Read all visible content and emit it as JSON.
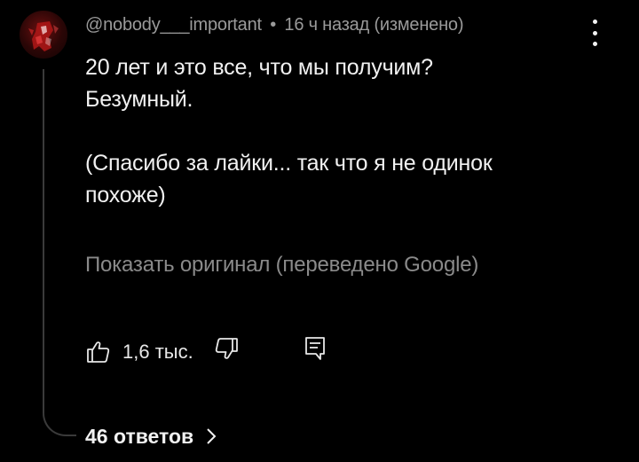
{
  "comment": {
    "author": "@nobody___important",
    "separator": "•",
    "time": "16 ч назад",
    "edited": "(изменено)",
    "text_line1": "20 лет и это все, что мы получим?",
    "text_line2": "Безумный.",
    "text_line3": "(Спасибо за лайки... так что я не одинок",
    "text_line4": "похоже)",
    "translate_label": "Показать оригинал (переведено Google)"
  },
  "actions": {
    "like_count": "1,6 тыс."
  },
  "replies": {
    "label": "46 ответов"
  },
  "icons": {
    "avatar": "avatar-image",
    "more": "more-vertical-icon",
    "like": "thumb-up-icon",
    "dislike": "thumb-down-icon",
    "reply": "reply-comment-icon",
    "chevron": "chevron-right-icon"
  },
  "colors": {
    "background": "#000000",
    "text": "#f1f1f1",
    "meta": "#9a9a9a",
    "thread": "#3a3a3a"
  }
}
